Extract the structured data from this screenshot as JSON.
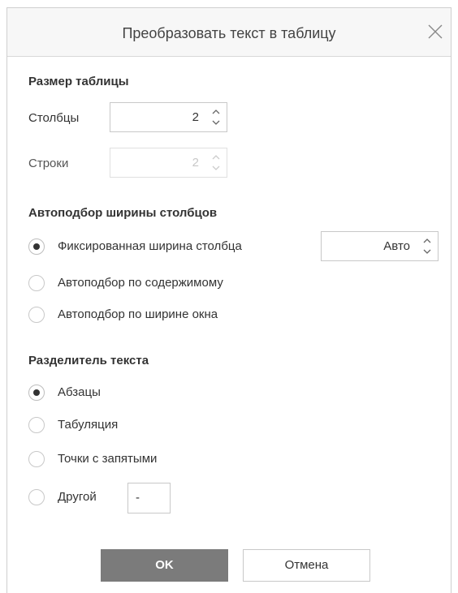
{
  "dialog": {
    "title": "Преобразовать текст в таблицу"
  },
  "table_size": {
    "heading": "Размер таблицы",
    "columns_label": "Столбцы",
    "columns_value": "2",
    "rows_label": "Строки",
    "rows_value": "2"
  },
  "autofit": {
    "heading": "Автоподбор ширины столбцов",
    "options": [
      {
        "label": "Фиксированная ширина столбца",
        "checked": true
      },
      {
        "label": "Автоподбор по содержимому",
        "checked": false
      },
      {
        "label": "Автоподбор по ширине окна",
        "checked": false
      }
    ],
    "fixed_width_value": "Авто"
  },
  "separator": {
    "heading": "Разделитель текста",
    "options": [
      {
        "label": "Абзацы",
        "checked": true
      },
      {
        "label": "Табуляция",
        "checked": false
      },
      {
        "label": "Точки с запятыми",
        "checked": false
      },
      {
        "label": "Другой",
        "checked": false
      }
    ],
    "other_value": "-"
  },
  "buttons": {
    "ok_label": "OK",
    "cancel_label": "Отмена"
  }
}
